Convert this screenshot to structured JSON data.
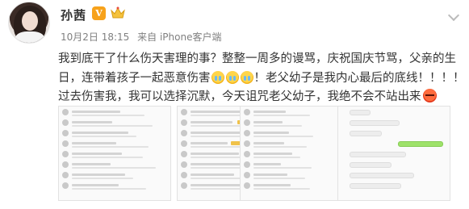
{
  "post": {
    "author": "孙茜",
    "badge": "V",
    "date": "10月2日 18:15",
    "via": "来自 iPhone客户端",
    "lines": [
      "我到底干了什么伤天害理的事？整整一周多的谩骂，庆祝国庆节骂，父亲的生",
      "日，连带着孩子一起恶意伤害",
      "！老父幼子是我内心最后的底线！！！！",
      "过去伤害我，我可以选择沉默，今天诅咒老父幼子，我绝不会不站出来"
    ]
  },
  "icons": {
    "avatar": "avatar-photo",
    "vip": "verified-badge",
    "crown": "crown-icon",
    "menu": "chevron-down-icon"
  },
  "colors": {
    "accent": "#f7a21b",
    "text": "#333333",
    "meta": "#808080"
  }
}
